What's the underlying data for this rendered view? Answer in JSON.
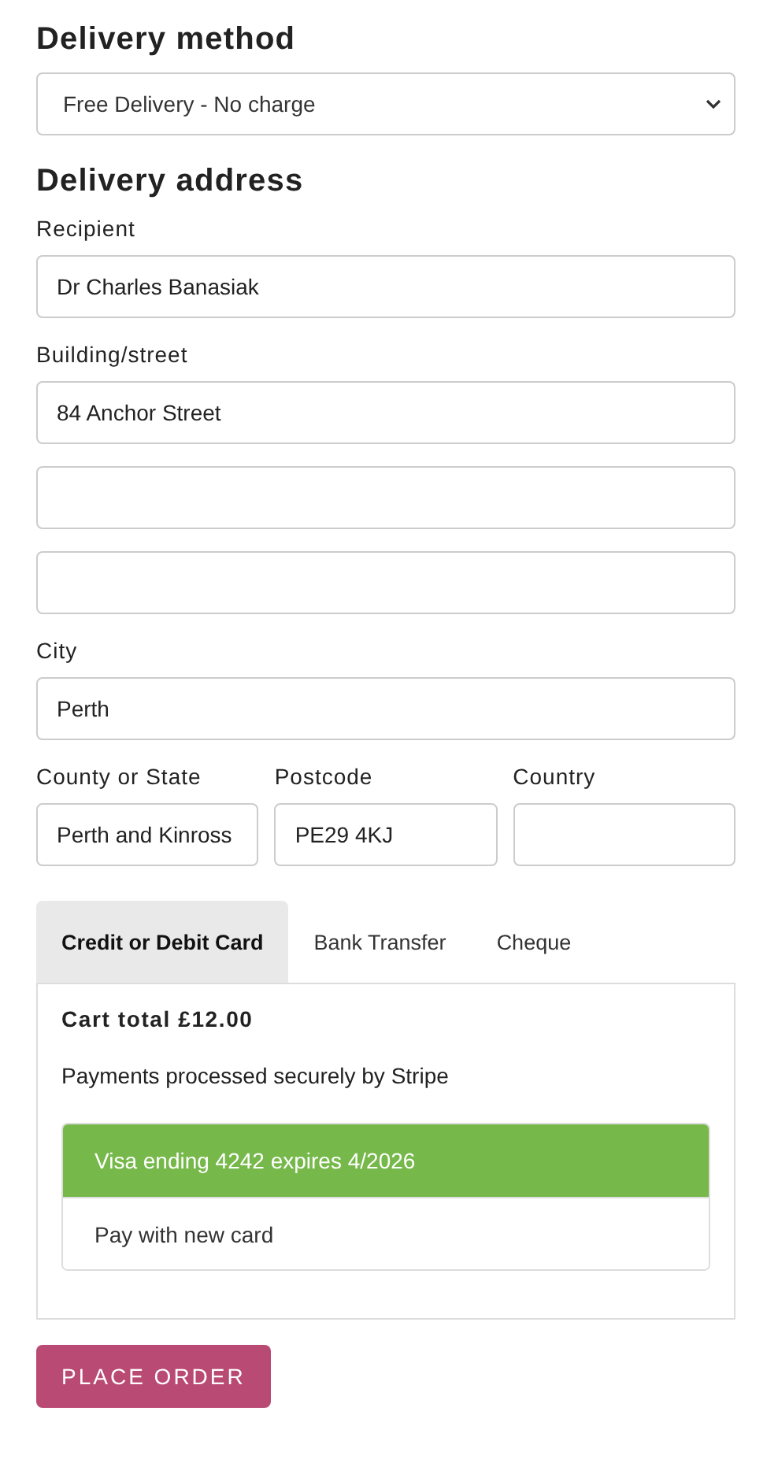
{
  "delivery_method": {
    "heading": "Delivery method",
    "value": "Free Delivery - No charge"
  },
  "delivery_address": {
    "heading": "Delivery address",
    "fields": [
      {
        "label": "Recipient",
        "inputs": [
          {
            "kind": "text",
            "value": "Dr Charles Banasiak"
          }
        ]
      },
      {
        "label": "Building/street",
        "inputs": [
          {
            "kind": "text",
            "value": "84 Anchor Street"
          },
          {
            "kind": "text"
          },
          {
            "kind": "text"
          }
        ]
      },
      {
        "label": "City",
        "inputs": [
          {
            "kind": "text",
            "value": "Perth"
          }
        ]
      }
    ],
    "row_fields": [
      {
        "label": "County or State",
        "value": "Perth and Kinross"
      },
      {
        "label": "Postcode",
        "value": "PE29 4KJ"
      },
      {
        "label": "Country"
      }
    ]
  },
  "payment_tabs": [
    {
      "label": "Credit or Debit Card",
      "selected": true
    },
    {
      "label": "Bank Transfer",
      "selected": false
    },
    {
      "label": "Cheque",
      "selected": false
    }
  ],
  "cart_total": "Cart total £12.00",
  "stripe_note": "Payments processed securely by Stripe",
  "cards": [
    {
      "label": "Visa ending 4242 expires 4/2026",
      "selected": true
    },
    {
      "label": "Pay with new card",
      "selected": false
    }
  ],
  "place_order_button": "PLACE ORDER"
}
